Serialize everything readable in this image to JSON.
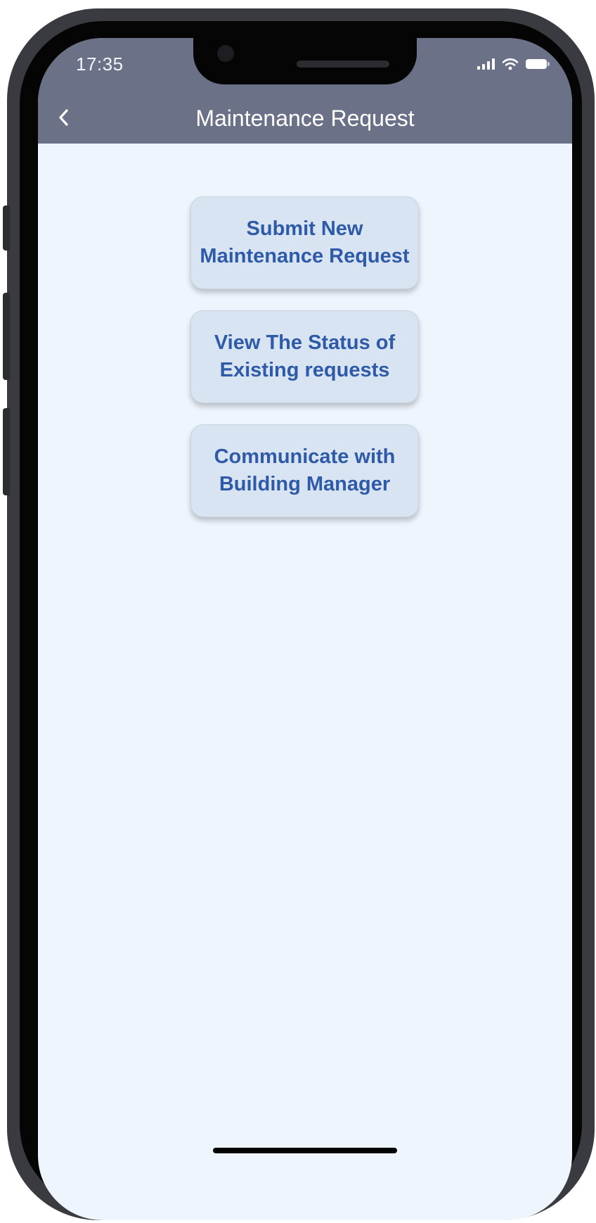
{
  "status_bar": {
    "time": "17:35",
    "icons": [
      "signal-icon",
      "wifi-icon",
      "battery-icon"
    ]
  },
  "header": {
    "back_icon": "chevron-left-icon",
    "title": "Maintenance Request"
  },
  "actions": [
    {
      "label": "Submit New Maintenance Request"
    },
    {
      "label": "View The Status of Existing requests"
    },
    {
      "label": "Communicate with Building Manager"
    }
  ],
  "colors": {
    "header_bg": "#6b7186",
    "screen_bg": "#eef5fd",
    "button_bg": "#d8e4f1",
    "button_text": "#2e5aa8"
  }
}
